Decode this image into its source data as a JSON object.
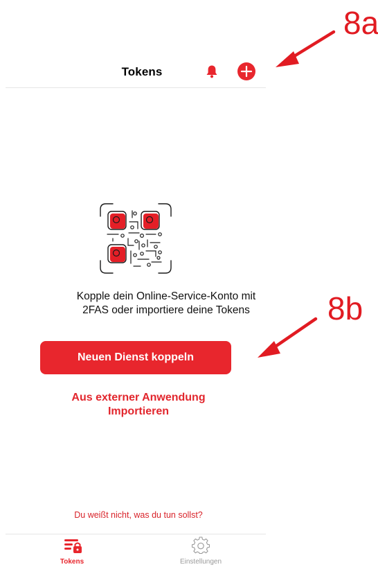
{
  "annotations": {
    "label_a": "8a",
    "label_b": "8b"
  },
  "header": {
    "title": "Tokens",
    "icons": [
      "bell-icon",
      "add-circle-icon"
    ]
  },
  "empty_state": {
    "illustration": "qr-code-icon",
    "message_line1": "Kopple dein Online-Service-Konto mit",
    "message_line2": "2FAS oder importiere deine Tokens",
    "primary_button": "Neuen Dienst koppeln",
    "import_line1": "Aus externer Anwendung",
    "import_line2": "Importieren",
    "help_link": "Du weißt nicht, was du tun sollst?"
  },
  "tabbar": {
    "tabs": [
      {
        "label": "Tokens",
        "icon": "tokens-icon",
        "active": true
      },
      {
        "label": "Einstellungen",
        "icon": "gear-icon",
        "active": false
      }
    ]
  },
  "colors": {
    "accent": "#e8262d",
    "annotation": "#e11b22",
    "inactive_tab": "#9a9a9a"
  }
}
